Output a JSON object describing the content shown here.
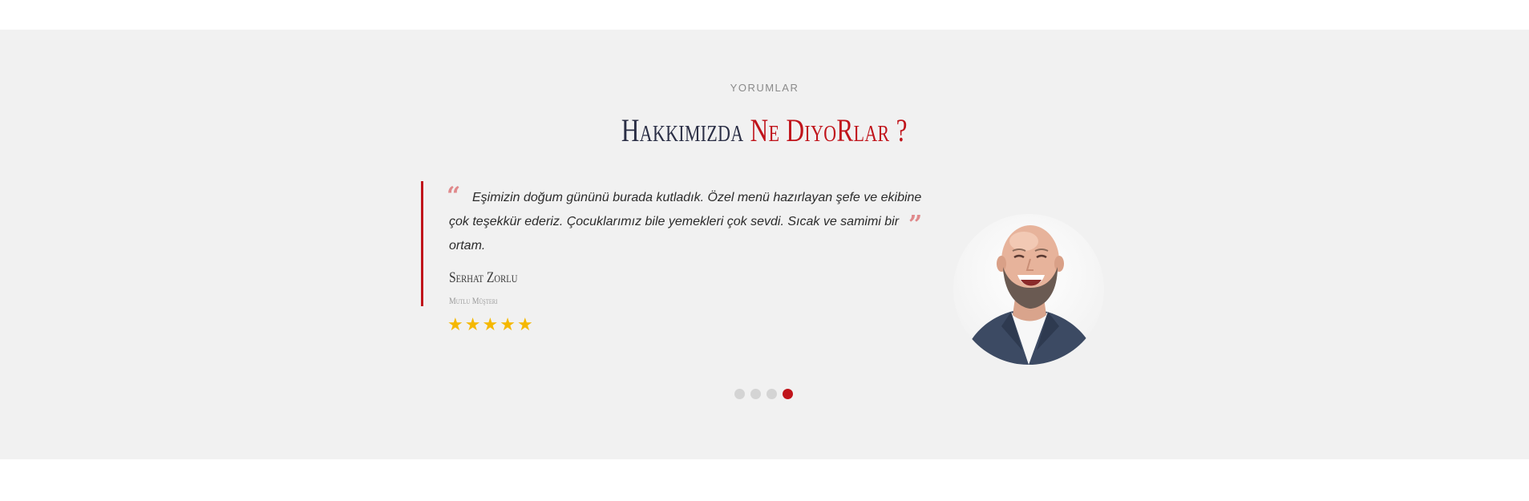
{
  "section": {
    "kicker": "YORUMLAR",
    "heading_part1": "Hakkımızda",
    "heading_part2": "Ne DiyoRlar ?"
  },
  "testimonial": {
    "quote": "Eşimizin doğum gününü burada kutladık. Özel menü hazırlayan şefe ve ekibine çok teşekkür ederiz. Çocuklarımız bile yemekleri çok sevdi. Sıcak ve samimi bir ortam.",
    "quote_open": "“",
    "quote_close": "”",
    "author": "Serhat Zorlu",
    "role": "Mutlu Müşteri",
    "rating": 5,
    "rating_max": 5
  },
  "carousel": {
    "count": 4,
    "active_index": 3
  },
  "colors": {
    "accent": "#c0141b",
    "heading_dark": "#2a2e45",
    "star": "#f5b800",
    "quote_mark": "#e0898b",
    "section_bg": "#f1f1f1"
  },
  "icons": {
    "star": "star-icon",
    "quote_open": "quote-open-icon",
    "quote_close": "quote-close-icon"
  }
}
